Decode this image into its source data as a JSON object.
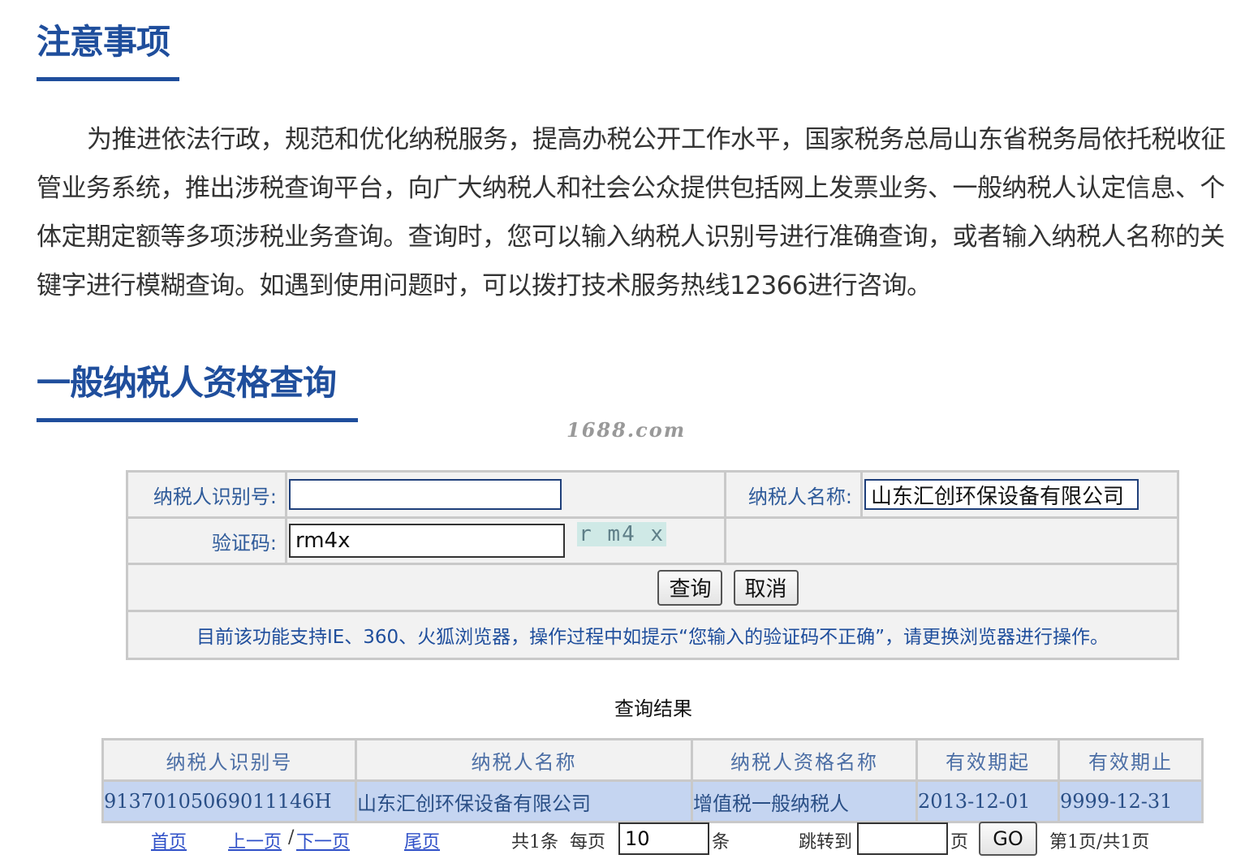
{
  "notice": {
    "title": "注意事项",
    "body": "为推进依法行政，规范和优化纳税服务，提高办税公开工作水平，国家税务总局山东省税务局依托税收征管业务系统，推出涉税查询平台，向广大纳税人和社会公众提供包括网上发票业务、一般纳税人认定信息、个体定期定额等多项涉税业务查询。查询时，您可以输入纳税人识别号进行准确查询，或者输入纳税人名称的关键字进行模糊查询。如遇到使用问题时，可以拨打技术服务热线12366进行咨询。"
  },
  "query": {
    "title": "一般纳税人资格查询",
    "watermark": "1688.com",
    "taxpayer_id_label": "纳税人识别号:",
    "taxpayer_id_value": "",
    "taxpayer_name_label": "纳税人名称:",
    "taxpayer_name_value": "山东汇创环保设备有限公司",
    "captcha_label": "验证码:",
    "captcha_value": "rm4x",
    "captcha_image_text": "r m4 x",
    "search_button": "查询",
    "cancel_button": "取消",
    "tip": "目前该功能支持IE、360、火狐浏览器，操作过程中如提示“您输入的验证码不正确”，请更换浏览器进行操作。"
  },
  "results": {
    "title": "查询结果",
    "columns": [
      "纳税人识别号",
      "纳税人名称",
      "纳税人资格名称",
      "有效期起",
      "有效期止"
    ],
    "rows": [
      [
        "91370105069011146H",
        "山东汇创环保设备有限公司",
        "增值税一般纳税人",
        "2013-12-01",
        "9999-12-31"
      ]
    ]
  },
  "pager": {
    "first": "首页",
    "prev": "上一页",
    "separator": "/",
    "next": "下一页",
    "last": "尾页",
    "total": "共1条",
    "per_page_label": "每页",
    "per_page_value": "10",
    "per_page_unit": "条",
    "jump_label": "跳转到",
    "jump_value": "",
    "page_unit": "页",
    "go_button": "GO",
    "page_info": "第1页/共1页"
  },
  "colors": {
    "heading_blue": "#1f4e9c",
    "label_blue": "#2f5b9a",
    "row_highlight": "#c5d5f1",
    "link_blue": "#2f50c8"
  }
}
